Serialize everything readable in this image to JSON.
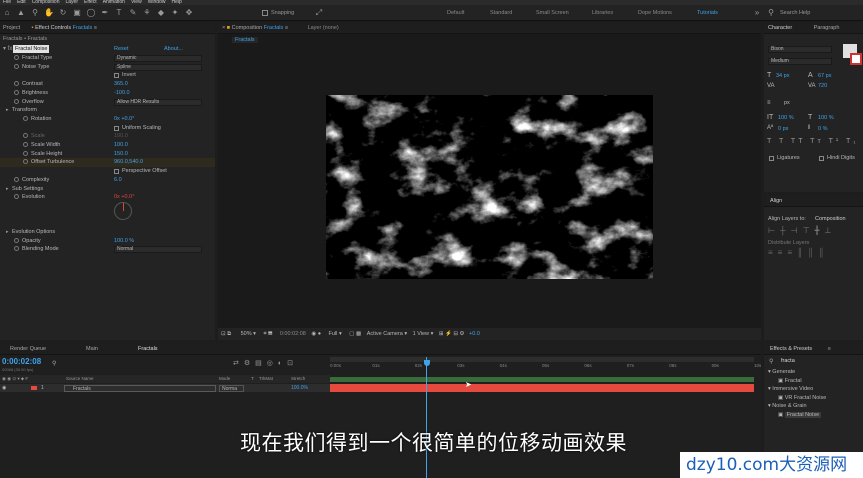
{
  "menubar": {
    "items": [
      "File",
      "Edit",
      "Composition",
      "Layer",
      "Effect",
      "Animation",
      "View",
      "Window",
      "Help"
    ]
  },
  "toolbar": {
    "snapping_label": "Snapping",
    "workspaces": [
      "Default",
      "Standard",
      "Small Screen",
      "Libraries",
      "Dope Motions",
      "Tutorials"
    ],
    "active_workspace": "Tutorials",
    "search_placeholder": "Search Help"
  },
  "project_panel": {
    "tab_project": "Project",
    "tab_effect_controls": "Effect Controls",
    "effect_controls_target": "Fractals",
    "breadcrumb": "Fractals • Fractals"
  },
  "effect_controls": {
    "effect_name": "Fractal Noise",
    "reset": "Reset",
    "about": "About...",
    "rows": [
      {
        "label": "Fractal Type",
        "value": "Dynamic",
        "kind": "dropdown"
      },
      {
        "label": "Noise Type",
        "value": "Spline",
        "kind": "dropdown"
      },
      {
        "label": "",
        "value": "Invert",
        "kind": "checkbox"
      },
      {
        "label": "Contrast",
        "value": "365.0",
        "kind": "number"
      },
      {
        "label": "Brightness",
        "value": "-100.0",
        "kind": "number"
      },
      {
        "label": "Overflow",
        "value": "Allow HDR Results",
        "kind": "dropdown"
      },
      {
        "label": "Transform",
        "value": "",
        "kind": "group"
      },
      {
        "label": "Rotation",
        "value": "0x +0.0°",
        "kind": "number"
      },
      {
        "label": "",
        "value": "Uniform Scaling",
        "kind": "checkbox"
      },
      {
        "label": "Scale",
        "value": "100.0",
        "kind": "number"
      },
      {
        "label": "Scale Width",
        "value": "100.0",
        "kind": "number"
      },
      {
        "label": "Scale Height",
        "value": "150.0",
        "kind": "number"
      },
      {
        "label": "Offset Turbulence",
        "value": "960.0,540.0",
        "kind": "number"
      },
      {
        "label": "",
        "value": "Perspective Offset",
        "kind": "checkbox"
      },
      {
        "label": "Complexity",
        "value": "6.0",
        "kind": "number"
      },
      {
        "label": "Sub Settings",
        "value": "",
        "kind": "group"
      },
      {
        "label": "Evolution",
        "value": "0x +0.0°",
        "kind": "number"
      },
      {
        "label": "",
        "value": "",
        "kind": "dial"
      },
      {
        "label": "",
        "value": "",
        "kind": "spacer"
      },
      {
        "label": "",
        "value": "",
        "kind": "spacer"
      },
      {
        "label": "Evolution Options",
        "value": "",
        "kind": "group"
      },
      {
        "label": "Opacity",
        "value": "100.0 %",
        "kind": "number"
      },
      {
        "label": "Blending Mode",
        "value": "Normal",
        "kind": "dropdown"
      }
    ]
  },
  "composition": {
    "tab_label": "Composition",
    "comp_name": "Fractals",
    "layer_tab": "Layer (none)",
    "breadcrumb": "Fractals",
    "zoom": "50%",
    "timecode": "0:00:02:08",
    "resolution": "Full",
    "camera": "Active Camera",
    "view": "1 View",
    "exposure": "+0.0"
  },
  "character": {
    "tab_character": "Character",
    "tab_paragraph": "Paragraph",
    "font": "Bison",
    "style": "Medium",
    "font_size": "34 px",
    "leading": "67 px",
    "kerning": "Metrics",
    "tracking": "720",
    "unit": "px",
    "vert_scale": "100 %",
    "horiz_scale": "100 %",
    "baseline": "0 px",
    "tsume": "0 %",
    "ligatures": "Ligatures",
    "hindi_digits": "Hindi Digits"
  },
  "align": {
    "title": "Align",
    "align_to_label": "Align Layers to:",
    "align_to_value": "Composition",
    "distribute_label": "Distribute Layers"
  },
  "effects_presets": {
    "title": "Effects & Presets",
    "search_value": "fracta",
    "tree": [
      {
        "label": "Generate",
        "level": 0
      },
      {
        "label": "Fractal",
        "level": 1
      },
      {
        "label": "Immersive Video",
        "level": 0
      },
      {
        "label": "VR Fractal Noise",
        "level": 1
      },
      {
        "label": "Noise & Grain",
        "level": 0
      },
      {
        "label": "Fractal Noise",
        "level": 1
      }
    ]
  },
  "timeline": {
    "tabs": [
      "Render Queue",
      "Main",
      "Fractals"
    ],
    "active_tab": "Fractals",
    "timecode": "0:00:02:08",
    "frame_info": "00068 (30.00 fps)",
    "search_placeholder": "",
    "col_source": "Source Name",
    "col_mode": "Mode",
    "col_t": "T",
    "col_trkmat": "TrkMat",
    "col_stretch": "Stretch",
    "layer": {
      "index": "1",
      "name": "Fractals",
      "mode": "Norma",
      "stretch": "100.0%"
    },
    "ruler": [
      "0:00s",
      "01s",
      "02s",
      "03s",
      "04s",
      "05s",
      "06s",
      "07s",
      "08s",
      "09s",
      "10s"
    ],
    "playhead_seconds": 2.27,
    "bar_color": "#e64a3f"
  },
  "subtitle": "现在我们得到一个很简单的位移动画效果",
  "watermark": "dzy10.com大资源网"
}
